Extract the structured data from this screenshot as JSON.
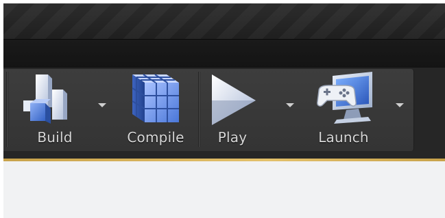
{
  "toolbar": {
    "buttons": [
      {
        "label": "Build",
        "icon": "build-icon",
        "has_dropdown": true
      },
      {
        "label": "Compile",
        "icon": "compile-icon",
        "has_dropdown": false
      },
      {
        "label": "Play",
        "icon": "play-icon",
        "has_dropdown": true
      },
      {
        "label": "Launch",
        "icon": "launch-icon",
        "has_dropdown": true
      }
    ]
  },
  "colors": {
    "toolbar_bg": "#343434",
    "label_text": "#d7d7d7",
    "accent": "#e3c06a",
    "viewport_bg": "#f1f2f3"
  }
}
